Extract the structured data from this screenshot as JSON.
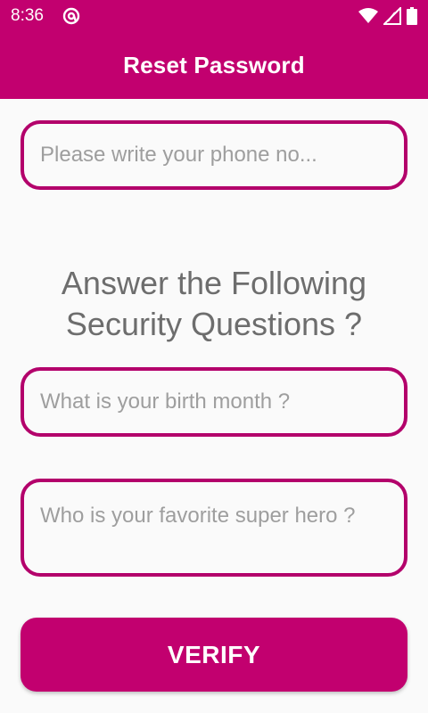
{
  "status_bar": {
    "time": "8:36",
    "icons": [
      "at-sign-icon",
      "wifi-icon",
      "cell-signal-icon",
      "battery-icon"
    ]
  },
  "app_bar": {
    "title": "Reset Password",
    "color": "#c2006f"
  },
  "form": {
    "phone_placeholder": "Please write your phone no...",
    "heading": "Answer the Following Security Questions ?",
    "birth_month_placeholder": "What is your birth month ?",
    "super_hero_placeholder": "Who is your favorite super hero ?",
    "verify_label": "VERIFY"
  },
  "colors": {
    "accent": "#c2006f",
    "field_border": "#b3006b",
    "heading_text": "#6d6d6d",
    "placeholder_text": "#9e9e9e"
  }
}
